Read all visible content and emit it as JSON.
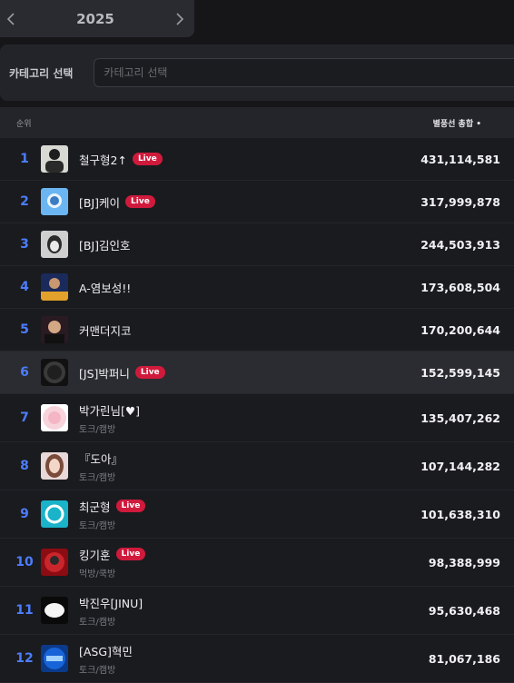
{
  "year_selector": {
    "year": "2025",
    "prev_icon": "chevron-left-icon",
    "next_icon": "chevron-right-icon"
  },
  "category": {
    "label": "카테고리 선택",
    "placeholder": "카테고리 선택"
  },
  "table": {
    "col_rank": "순위",
    "col_total": "별풍선 총합 •",
    "rows": [
      {
        "rank": "1",
        "name": "철구형2↑",
        "sub": "",
        "live": "Live",
        "total": "431,114,581"
      },
      {
        "rank": "2",
        "name": "[BJ]케이",
        "sub": "",
        "live": "Live",
        "total": "317,999,878"
      },
      {
        "rank": "3",
        "name": "[BJ]김인호",
        "sub": "",
        "live": "",
        "total": "244,503,913"
      },
      {
        "rank": "4",
        "name": "A-염보성!!",
        "sub": "",
        "live": "",
        "total": "173,608,504"
      },
      {
        "rank": "5",
        "name": "커맨더지코",
        "sub": "",
        "live": "",
        "total": "170,200,644"
      },
      {
        "rank": "6",
        "name": "[JS]박퍼니",
        "sub": "",
        "live": "Live",
        "total": "152,599,145"
      },
      {
        "rank": "7",
        "name": "박가린님[♥]",
        "sub": "토크/캠방",
        "live": "",
        "total": "135,407,262"
      },
      {
        "rank": "8",
        "name": "『도아』",
        "sub": "토크/캠방",
        "live": "",
        "total": "107,144,282"
      },
      {
        "rank": "9",
        "name": "최군형",
        "sub": "토크/캠방",
        "live": "Live",
        "total": "101,638,310"
      },
      {
        "rank": "10",
        "name": "킹기훈",
        "sub": "먹방/쿡방",
        "live": "Live",
        "total": "98,388,999"
      },
      {
        "rank": "11",
        "name": "박진우[JINU]",
        "sub": "토크/캠방",
        "live": "",
        "total": "95,630,468"
      },
      {
        "rank": "12",
        "name": "[ASG]혁민",
        "sub": "토크/캠방",
        "live": "",
        "total": "81,067,186"
      }
    ]
  }
}
